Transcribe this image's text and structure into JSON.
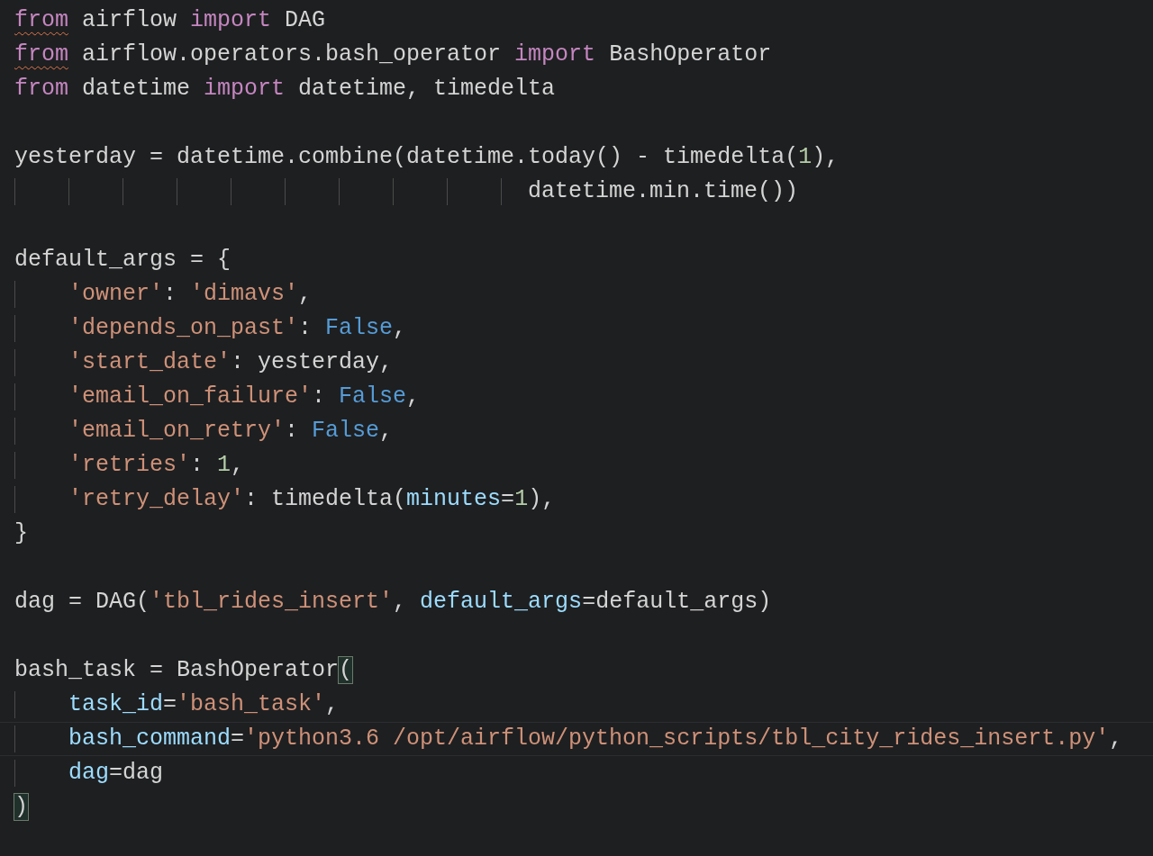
{
  "editor": {
    "lines": [
      {
        "kind": "code",
        "tokens": [
          {
            "kind": "kw",
            "text": "from",
            "squiggle": true
          },
          {
            "kind": "plain",
            "text": " airflow "
          },
          {
            "kind": "kw",
            "text": "import"
          },
          {
            "kind": "plain",
            "text": " DAG"
          }
        ]
      },
      {
        "kind": "code",
        "tokens": [
          {
            "kind": "kw",
            "text": "from",
            "squiggle": true
          },
          {
            "kind": "plain",
            "text": " airflow.operators.bash_operator "
          },
          {
            "kind": "kw",
            "text": "import"
          },
          {
            "kind": "plain",
            "text": " BashOperator"
          }
        ]
      },
      {
        "kind": "code",
        "tokens": [
          {
            "kind": "kw",
            "text": "from"
          },
          {
            "kind": "plain",
            "text": " datetime "
          },
          {
            "kind": "kw",
            "text": "import"
          },
          {
            "kind": "plain",
            "text": " datetime, timedelta"
          }
        ]
      },
      {
        "kind": "blank"
      },
      {
        "kind": "code",
        "tokens": [
          {
            "kind": "plain",
            "text": "yesterday = datetime.combine(datetime.today() - timedelta("
          },
          {
            "kind": "num",
            "text": "1"
          },
          {
            "kind": "plain",
            "text": "),"
          }
        ]
      },
      {
        "kind": "code",
        "tokens": [
          {
            "kind": "indent"
          },
          {
            "kind": "indent"
          },
          {
            "kind": "indent"
          },
          {
            "kind": "indent"
          },
          {
            "kind": "indent"
          },
          {
            "kind": "indent"
          },
          {
            "kind": "indent"
          },
          {
            "kind": "indent"
          },
          {
            "kind": "indent"
          },
          {
            "kind": "half_indent"
          },
          {
            "kind": "plain",
            "text": "datetime.min.time())"
          }
        ]
      },
      {
        "kind": "blank"
      },
      {
        "kind": "code",
        "tokens": [
          {
            "kind": "plain",
            "text": "default_args = {"
          }
        ]
      },
      {
        "kind": "code",
        "tokens": [
          {
            "kind": "indent"
          },
          {
            "kind": "str",
            "text": "'owner'"
          },
          {
            "kind": "plain",
            "text": ": "
          },
          {
            "kind": "str",
            "text": "'dimavs'"
          },
          {
            "kind": "plain",
            "text": ","
          }
        ]
      },
      {
        "kind": "code",
        "tokens": [
          {
            "kind": "indent"
          },
          {
            "kind": "str",
            "text": "'depends_on_past'"
          },
          {
            "kind": "plain",
            "text": ": "
          },
          {
            "kind": "const",
            "text": "False"
          },
          {
            "kind": "plain",
            "text": ","
          }
        ]
      },
      {
        "kind": "code",
        "tokens": [
          {
            "kind": "indent"
          },
          {
            "kind": "str",
            "text": "'start_date'"
          },
          {
            "kind": "plain",
            "text": ": yesterday,"
          }
        ]
      },
      {
        "kind": "code",
        "tokens": [
          {
            "kind": "indent"
          },
          {
            "kind": "str",
            "text": "'email_on_failure'"
          },
          {
            "kind": "plain",
            "text": ": "
          },
          {
            "kind": "const",
            "text": "False"
          },
          {
            "kind": "plain",
            "text": ","
          }
        ]
      },
      {
        "kind": "code",
        "tokens": [
          {
            "kind": "indent"
          },
          {
            "kind": "str",
            "text": "'email_on_retry'"
          },
          {
            "kind": "plain",
            "text": ": "
          },
          {
            "kind": "const",
            "text": "False"
          },
          {
            "kind": "plain",
            "text": ","
          }
        ]
      },
      {
        "kind": "code",
        "tokens": [
          {
            "kind": "indent"
          },
          {
            "kind": "str",
            "text": "'retries'"
          },
          {
            "kind": "plain",
            "text": ": "
          },
          {
            "kind": "num",
            "text": "1"
          },
          {
            "kind": "plain",
            "text": ","
          }
        ]
      },
      {
        "kind": "code",
        "tokens": [
          {
            "kind": "indent"
          },
          {
            "kind": "str",
            "text": "'retry_delay'"
          },
          {
            "kind": "plain",
            "text": ": timedelta("
          },
          {
            "kind": "param",
            "text": "minutes"
          },
          {
            "kind": "plain",
            "text": "="
          },
          {
            "kind": "num",
            "text": "1"
          },
          {
            "kind": "plain",
            "text": "),"
          }
        ]
      },
      {
        "kind": "code",
        "tokens": [
          {
            "kind": "plain",
            "text": "}"
          }
        ]
      },
      {
        "kind": "blank"
      },
      {
        "kind": "code",
        "tokens": [
          {
            "kind": "plain",
            "text": "dag = DAG("
          },
          {
            "kind": "str",
            "text": "'tbl_rides_insert'"
          },
          {
            "kind": "plain",
            "text": ", "
          },
          {
            "kind": "param",
            "text": "default_args"
          },
          {
            "kind": "plain",
            "text": "=default_args)"
          }
        ]
      },
      {
        "kind": "blank"
      },
      {
        "kind": "code",
        "tokens": [
          {
            "kind": "plain",
            "text": "bash_task = BashOperator"
          },
          {
            "kind": "plain",
            "text": "(",
            "bracket_match": true
          }
        ]
      },
      {
        "kind": "code",
        "tokens": [
          {
            "kind": "indent"
          },
          {
            "kind": "param",
            "text": "task_id"
          },
          {
            "kind": "plain",
            "text": "="
          },
          {
            "kind": "str",
            "text": "'bash_task'"
          },
          {
            "kind": "plain",
            "text": ","
          }
        ]
      },
      {
        "kind": "code",
        "current": true,
        "tokens": [
          {
            "kind": "indent"
          },
          {
            "kind": "param",
            "text": "bash_command"
          },
          {
            "kind": "plain",
            "text": "="
          },
          {
            "kind": "str",
            "text": "'python3.6 /opt/airflow/python_scripts/tbl_city_rides_insert.py'"
          },
          {
            "kind": "plain",
            "text": ","
          }
        ]
      },
      {
        "kind": "code",
        "tokens": [
          {
            "kind": "indent"
          },
          {
            "kind": "param",
            "text": "dag"
          },
          {
            "kind": "plain",
            "text": "=dag"
          }
        ]
      },
      {
        "kind": "code",
        "tokens": [
          {
            "kind": "plain",
            "text": ")",
            "bracket_match": true
          }
        ]
      }
    ]
  }
}
